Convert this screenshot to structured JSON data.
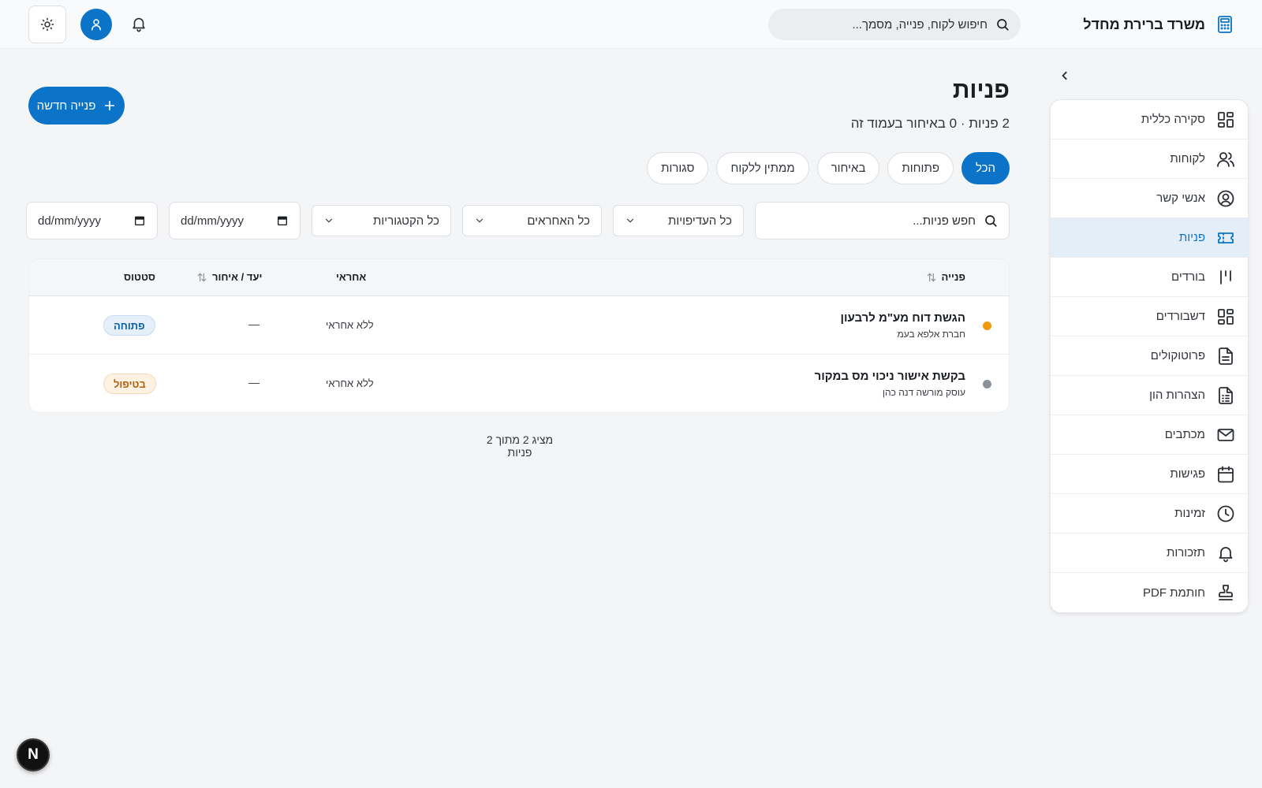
{
  "header": {
    "app_title": "משרד ברירת מחדל",
    "app_icon": "calculator-icon",
    "search_placeholder": "חיפוש לקוח, פנייה, מסמך...",
    "icons": [
      "bell-icon",
      "user-icon",
      "sun-icon"
    ]
  },
  "sidebar": {
    "items": [
      {
        "label": "סקירה כללית",
        "icon": "dashboard-grid-icon",
        "active": false
      },
      {
        "label": "לקוחות",
        "icon": "users-icon",
        "active": false
      },
      {
        "label": "אנשי קשר",
        "icon": "user-circle-icon",
        "active": false
      },
      {
        "label": "פניות",
        "icon": "ticket-icon",
        "active": true
      },
      {
        "label": "בורדים",
        "icon": "kanban-icon",
        "active": false
      },
      {
        "label": "דשבורדים",
        "icon": "layout-grid-icon",
        "active": false
      },
      {
        "label": "פרוטוקולים",
        "icon": "document-icon",
        "active": false
      },
      {
        "label": "הצהרות הון",
        "icon": "spreadsheet-icon",
        "active": false
      },
      {
        "label": "מכתבים",
        "icon": "mail-icon",
        "active": false
      },
      {
        "label": "פגישות",
        "icon": "calendar-icon",
        "active": false
      },
      {
        "label": "זמינות",
        "icon": "clock-icon",
        "active": false
      },
      {
        "label": "תזכורות",
        "icon": "bell-icon",
        "active": false
      },
      {
        "label": "חותמת PDF",
        "icon": "stamp-icon",
        "active": false
      }
    ]
  },
  "page": {
    "title": "פניות",
    "subtitle": "2 פניות · 0 באיחור בעמוד זה",
    "new_button_label": "פנייה חדשה"
  },
  "tabs": [
    {
      "label": "הכל",
      "active": true
    },
    {
      "label": "פתוחות",
      "active": false
    },
    {
      "label": "באיחור",
      "active": false
    },
    {
      "label": "ממתין ללקוח",
      "active": false
    },
    {
      "label": "סגורות",
      "active": false
    }
  ],
  "filters": {
    "search_placeholder": "חפש פניות...",
    "priority_value": "כל העדיפויות",
    "assignee_value": "כל האחראים",
    "category_value": "כל הקטגוריות",
    "date_from_placeholder": "dd/mm/yyyy",
    "date_to_placeholder": "dd/mm/yyyy"
  },
  "table": {
    "columns": {
      "inquiry": "פנייה",
      "assignee": "אחראי",
      "due": "יעד / איחור",
      "status": "סטטוס"
    },
    "rows": [
      {
        "title": "הגשת דוח מע\"מ לרבעון",
        "client": "חברת אלפא בעמ",
        "assignee": "ללא אחראי",
        "due": "—",
        "status": "פתוחה",
        "status_kind": "open",
        "dot_color": "#f29a0e"
      },
      {
        "title": "בקשת אישור ניכוי מס במקור",
        "client": "עוסק מורשה דנה כהן",
        "assignee": "ללא אחראי",
        "due": "—",
        "status": "בטיפול",
        "status_kind": "progress",
        "dot_color": "#8e9399"
      }
    ]
  },
  "footer": {
    "count_text": "מציג 2 מתוך 2 פניות"
  },
  "dev_badge": {
    "letter": "N"
  },
  "colors": {
    "accent": "#0b74c8",
    "active_bg": "#e3eef8"
  }
}
